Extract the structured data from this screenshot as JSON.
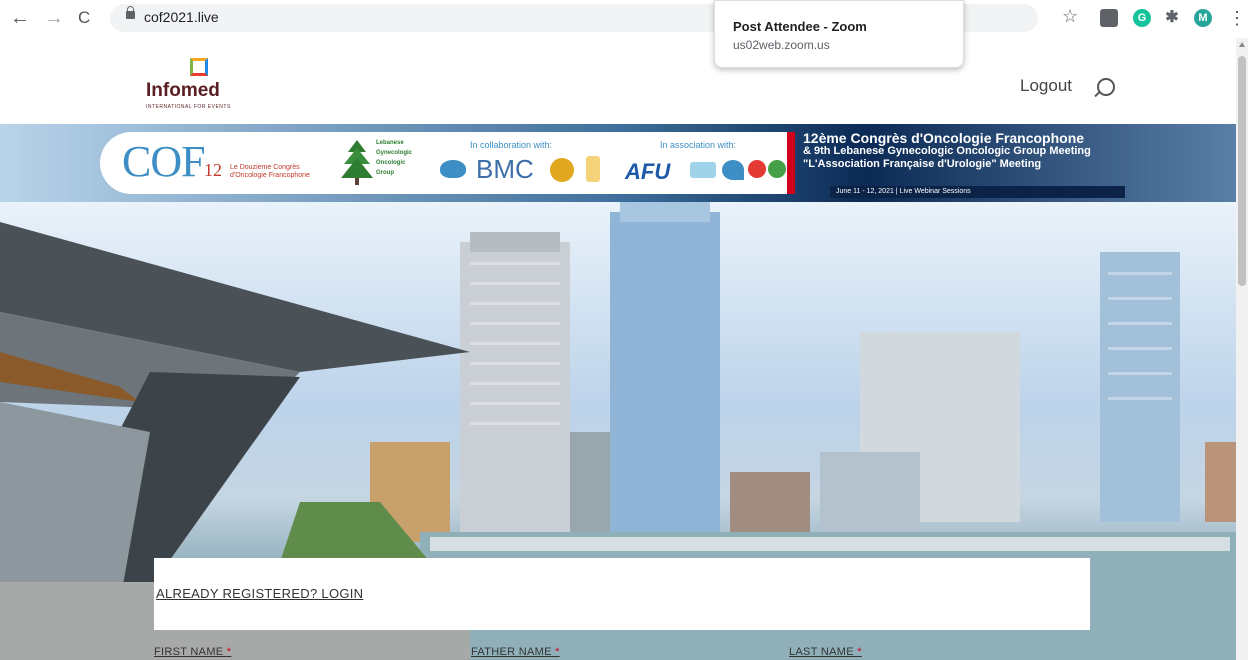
{
  "browser": {
    "url": "cof2021.live",
    "back_icon": "←",
    "forward_icon": "→",
    "reload_icon": "C",
    "star_icon": "☆",
    "ext_grammarly": "G",
    "ext_avatar": "M",
    "menu_icon": "⋮"
  },
  "tooltip": {
    "title": "Post Attendee - Zoom",
    "subtitle": "us02web.zoom.us"
  },
  "header": {
    "logo_text": "Infomed",
    "logo_tagline": "INTERNATIONAL FOR EVENTS",
    "logout_label": "Logout"
  },
  "banner": {
    "cof_letters": "COF",
    "cof_number": "12",
    "cof_subtitle_1": "Le Douzieme Congrès",
    "cof_subtitle_2": "d'Oncologie Francophone",
    "lgog_lines": [
      "Lebanese",
      "Gynecologic",
      "Oncologic",
      "Group"
    ],
    "collaboration_label": "In collaboration with:",
    "bmc_text": "BMC",
    "association_label": "In association with:",
    "afu_text": "AFU",
    "title_line_1": "12ème Congrès d'Oncologie Francophone",
    "title_line_2": "& 9th Lebanese Gynecologic Oncologic Group Meeting",
    "title_line_3": "\"L'Association Française d'Urologie\" Meeting",
    "date_line": "June 11 - 12, 2021  | Live Webinar Sessions"
  },
  "form": {
    "login_heading": "ALREADY REGISTERED? LOGIN",
    "first_name_label": "FIRST NAME",
    "father_name_label": "FATHER NAME",
    "last_name_label": "LAST NAME",
    "required_marker": "*"
  },
  "colors": {
    "brand_red": "#d0021b",
    "cof_blue": "#3d8ec4",
    "infomed_maroon": "#5a1f23"
  }
}
